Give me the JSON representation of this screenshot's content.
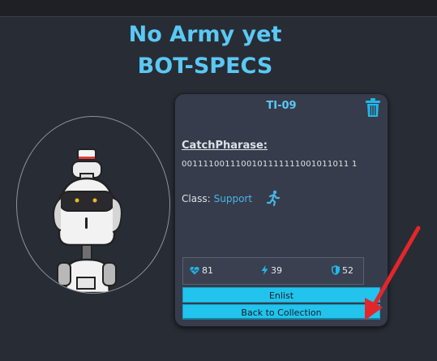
{
  "page": {
    "title": "No Army yet",
    "subtitle": "BOT-SPECS"
  },
  "bot": {
    "name": "TI-09",
    "catchphrase_label": "CatchPharase:",
    "catchphrase": "0011110011100101111111001011011 1",
    "class_label": "Class:",
    "class_value": "Support",
    "class_icon": "running-person-icon",
    "stats": {
      "health": "81",
      "damage": "39",
      "armor": "52"
    }
  },
  "actions": {
    "enlist_label": "Enlist",
    "back_label": "Back to Collection"
  },
  "colors": {
    "accent": "#5bc8f5",
    "button": "#22c4ed",
    "card": "#363c4b",
    "background": "#282c34",
    "annotation_arrow": "#e3262b"
  }
}
